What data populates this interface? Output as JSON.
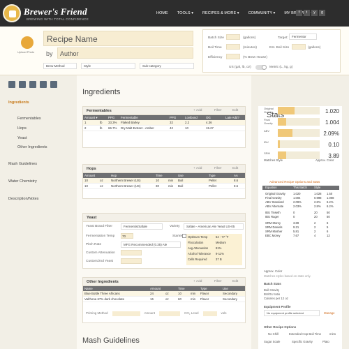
{
  "brand": {
    "name": "Brewer's Friend",
    "tagline": "BREWING WITH TOTAL CONFIDENCE"
  },
  "nav": [
    "HOME",
    "TOOLS",
    "RECIPES & MORE",
    "COMMUNITY",
    "MY BREWING"
  ],
  "nav_extra": {
    "tools": "TOOLS ▾",
    "recipes": "RECIPES & MORE ▾",
    "community": "COMMUNITY ▾",
    "mybrewing": "MY BREWING ▾"
  },
  "social": [
    "f",
    "t",
    "y",
    "g"
  ],
  "recipe": {
    "name_placeholder": "Recipe Name",
    "by": "by",
    "author_placeholder": "Author",
    "upload": "Upload Photo",
    "brew_method": "Brew Method",
    "style": "Style",
    "subcategory": "Sub-category"
  },
  "params": {
    "batch_size": "Batch Size",
    "batch_unit": "(gallons)",
    "boil_time": "Boil Time",
    "boil_unit": "(minutes)",
    "efficiency": "Efficiency",
    "eff_unit": "(% Brew House)",
    "target": "Target:",
    "target_val": "Fermentor",
    "est_boil": "Est. Boil Size",
    "est_unit": "(gallons)",
    "units_us": "US (gal, lb, oz)",
    "units_metric": "Metric (L, kg, g)"
  },
  "sidebar": [
    "Ingredients",
    "Fermentables",
    "Hops",
    "Yeast",
    "Other Ingredients",
    "Mash Guidelines",
    "Water Chemistry",
    "Description/Notes"
  ],
  "main": {
    "ingredients": "Ingredients",
    "mash": "Mash Guidelines"
  },
  "ferm": {
    "title": "Fermentables",
    "add": "+ Add",
    "filter": "Filter",
    "edit": "Edit",
    "cols": [
      "Amount ▾",
      "PPG",
      "Fermentable",
      "PPG",
      "Lovibond",
      "OG",
      "Late Add?"
    ],
    "rows": [
      [
        "1",
        "lb",
        "33.3%",
        "Flaked Barley",
        "32",
        "2.2",
        "4.36"
      ],
      [
        "2",
        "lb",
        "66.7%",
        "Dry Malt Extract - Amber",
        "42",
        "10",
        "15.27"
      ]
    ]
  },
  "hops": {
    "title": "Hops",
    "add": "+ Add",
    "filter": "Filter",
    "edit": "Edit",
    "cols": [
      "Amount",
      "Hop",
      "Time",
      "Use",
      "Type",
      "AA"
    ],
    "rows": [
      [
        "10",
        "oz",
        "Northern Brewer (US)",
        "10",
        "min",
        "Boil",
        "Pellet",
        "8.6"
      ],
      [
        "10",
        "oz",
        "Northern Brewer (US)",
        "30",
        "min",
        "Boil",
        "Pellet",
        "8.6"
      ]
    ]
  },
  "yeast": {
    "title": "Yeast",
    "brand_filter": "Yeast Brand Filter",
    "brand": "Fermentis/Safale",
    "variety": "Variety",
    "variety_val": "Safale - American Ale Yeast US-05",
    "ferm_temp": "Fermentation Temp",
    "temp_val": "70",
    "starter": "Starter",
    "pitch": "Pitch Rate",
    "pitch_val": "MFG Recommended (0.35) Ale",
    "custom1": "Custom Attenuation",
    "custom2": "Custom/2nd Yeast",
    "info": [
      [
        "Optimum Temp",
        "54 - 77 °F"
      ],
      [
        "Flocculation",
        "Medium"
      ],
      [
        "Avg Attenuation",
        "81%"
      ],
      [
        "Alcohol Tolerance",
        "9-11%"
      ],
      [
        "Cells Required",
        "37 B"
      ]
    ]
  },
  "other": {
    "title": "Other Ingredients",
    "add": "+ Add",
    "filter": "Filter",
    "edit": "Edit",
    "cols": [
      "Name",
      "Amount",
      "Time",
      "Type",
      "Use"
    ],
    "rows": [
      [
        "Blue Bottle Three Africans",
        "24",
        "oz",
        "10",
        "min",
        "Flavor",
        "Secondary"
      ],
      [
        "Valrhona 67% dark chocolate",
        "16",
        "oz",
        "60",
        "min",
        "Flavor",
        "Secondary"
      ]
    ],
    "priming": "Priming Method",
    "amount": "Amount",
    "co2": "CO₂ Level",
    "vols": "vols"
  },
  "stats": {
    "title": "Stats",
    "rows": [
      {
        "label": "Original Gravity",
        "value": "1.020",
        "fill": 0.4
      },
      {
        "label": "Final Gravity",
        "value": "1.004",
        "fill": 0.2
      },
      {
        "label": "ABV",
        "value": "2.09%",
        "fill": 0.35
      },
      {
        "label": "IBU",
        "value": "0.10",
        "fill": 0.05
      },
      {
        "label": "SRM",
        "value": "3.89",
        "fill": 0.2
      }
    ],
    "matches": "Matches Style",
    "color": "Approx. Color",
    "adv": "Advanced Recipe Options and Stats",
    "table_head": [
      "Equation",
      "This Batch",
      "Style"
    ],
    "grav": [
      [
        "Original Gravity",
        "1.020",
        "1.028",
        "1.50"
      ],
      [
        "Final Gravity",
        "1.004",
        "0.998",
        "1.008"
      ],
      [
        "ABV Standard",
        "2.09%",
        "2.8%",
        "6.2%"
      ],
      [
        "ABV Alternate",
        "2.03%",
        "2.8%",
        "6.2%"
      ]
    ],
    "ibu": [
      [
        "IBU Tinseth",
        "0",
        "20",
        "50"
      ],
      [
        "IBU Rager",
        "0",
        "20",
        "50"
      ]
    ],
    "srm": [
      [
        "SRM Morey",
        "3.89",
        "2",
        "6"
      ],
      [
        "SRM Daniels",
        "9.21",
        "2",
        "5"
      ],
      [
        "SRM Mosher",
        "5.81",
        "2",
        "6"
      ],
      [
        "EBC Morey",
        "7.67",
        "4",
        "12"
      ]
    ],
    "approx": "Approx. Color",
    "shown": "Matches styles based on stats only.",
    "batch": "Batch Stats",
    "boil_grav": "Boil Gravity",
    "bu_gu": "BU/GU ratio",
    "cal": "Calories per 12 oz",
    "equip": "Equipment Profile",
    "equip_sel": "No equipment profile selected",
    "manage": "Manage",
    "other_opts": "Other Recipe Options",
    "no_chill": "No Chill",
    "ext_hop": "Extended Hop Boil Time",
    "mins": "mins",
    "sugar": "Sugar Scale",
    "sg": "Specific Gravity",
    "plato": "Plato"
  },
  "colors": {
    "accent": "#d06a1a",
    "bar": "#f0c878",
    "nav": "#2d2d2d"
  }
}
